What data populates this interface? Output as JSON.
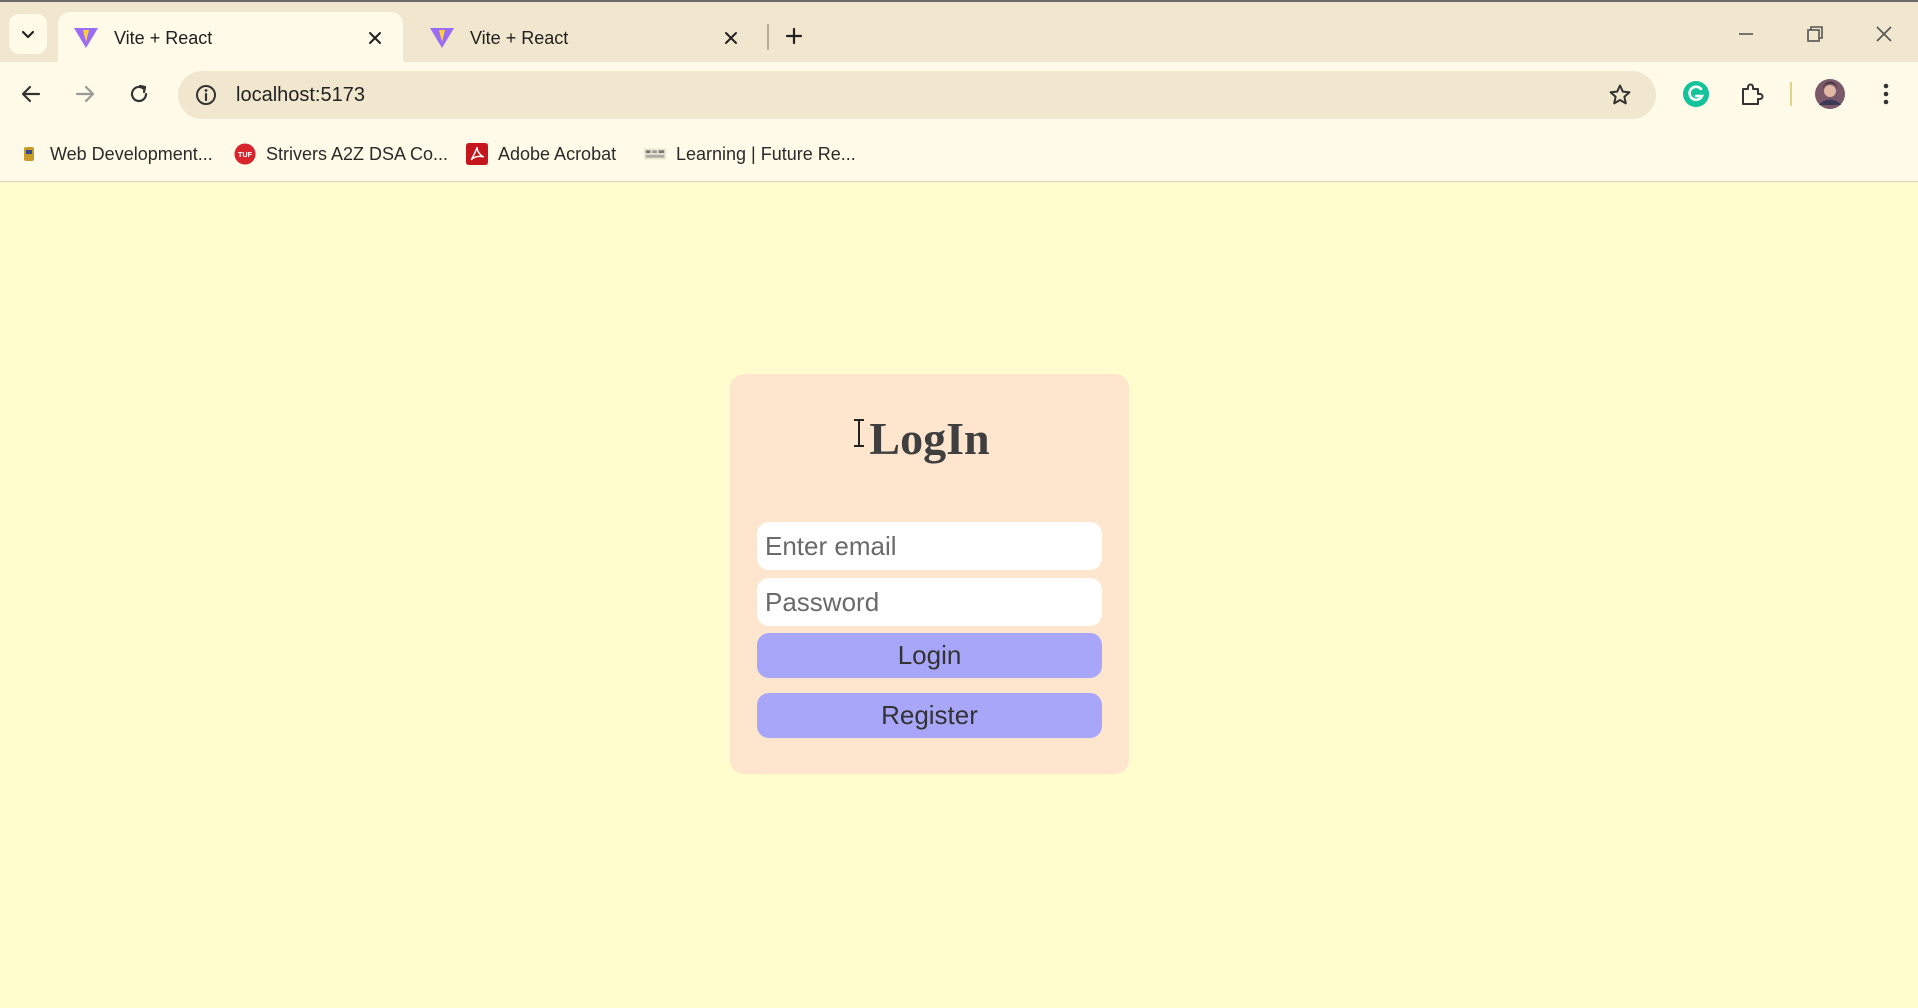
{
  "browser": {
    "tabs": [
      {
        "title": "Vite + React",
        "active": true
      },
      {
        "title": "Vite + React",
        "active": false
      }
    ],
    "address": {
      "url": "localhost:5173"
    },
    "bookmarks": [
      {
        "label": "Web Development...",
        "icon": "bookmark-favicon"
      },
      {
        "label": "Strivers A2Z DSA Co...",
        "icon": "tuf-logo",
        "icon_text": "TUF"
      },
      {
        "label": "Adobe Acrobat",
        "icon": "acrobat-icon"
      },
      {
        "label": "Learning | Future Re...",
        "icon": "learning-favicon"
      }
    ],
    "colors": {
      "chrome": "#f1e7cf",
      "toolbar": "#fffbe8",
      "grammarly": "#15c39a"
    }
  },
  "page": {
    "background": "#fffcce",
    "card_color": "#fde6cd",
    "button_color": "#a8a6f8",
    "login_form": {
      "title": "LogIn",
      "email_placeholder": "Enter email",
      "password_placeholder": "Password",
      "login_label": "Login",
      "register_label": "Register"
    }
  }
}
